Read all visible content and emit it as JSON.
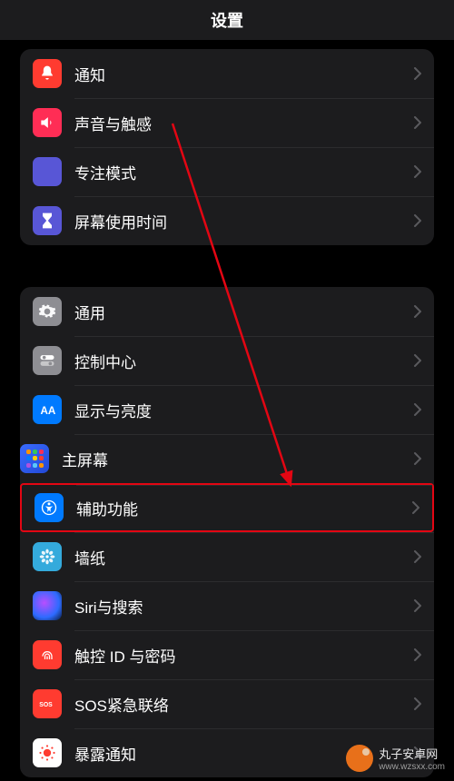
{
  "colors": {
    "highlight": "#e30613",
    "row_bg": "#1c1c1e"
  },
  "header": {
    "title": "设置"
  },
  "group1": {
    "items": [
      {
        "key": "notifications",
        "label": "通知",
        "icon_bg": "#ff3b30"
      },
      {
        "key": "sounds_haptics",
        "label": "声音与触感",
        "icon_bg": "#ff2d55"
      },
      {
        "key": "focus",
        "label": "专注模式",
        "icon_bg": "#5856d6"
      },
      {
        "key": "screen_time",
        "label": "屏幕使用时间",
        "icon_bg": "#5856d6"
      }
    ]
  },
  "group2": {
    "items": [
      {
        "key": "general",
        "label": "通用",
        "icon_bg": "#8e8e93"
      },
      {
        "key": "control_center",
        "label": "控制中心",
        "icon_bg": "#8e8e93"
      },
      {
        "key": "display_brightness",
        "label": "显示与亮度",
        "icon_bg": "#007aff"
      },
      {
        "key": "home_screen",
        "label": "主屏幕",
        "icon_bg": "#2c55d6"
      },
      {
        "key": "accessibility",
        "label": "辅助功能",
        "icon_bg": "#007aff",
        "highlighted": true
      },
      {
        "key": "wallpaper",
        "label": "墙纸",
        "icon_bg": "#34aadc"
      },
      {
        "key": "siri_search",
        "label": "Siri与搜索",
        "icon_bg": "#000000"
      },
      {
        "key": "touch_id_passcode",
        "label": "触控 ID 与密码",
        "icon_bg": "#ff3b30"
      },
      {
        "key": "sos",
        "label": "SOS紧急联络",
        "icon_bg": "#ff3b30"
      },
      {
        "key": "exposure_notification",
        "label": "暴露通知",
        "icon_bg": "#ffffff"
      }
    ]
  },
  "watermark": {
    "text": "丸子安卓网",
    "sub": "www.wzsxx.com"
  }
}
